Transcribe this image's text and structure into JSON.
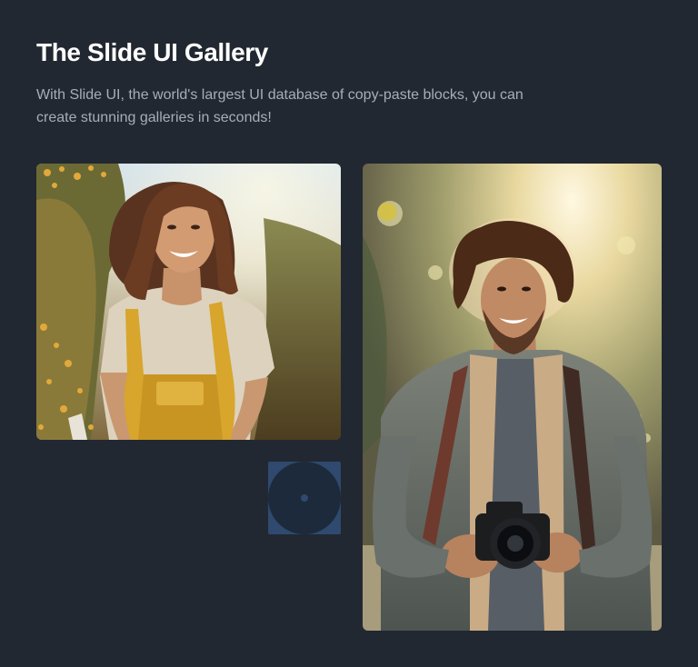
{
  "header": {
    "title": "The Slide UI Gallery",
    "description": "With Slide UI, the world's largest UI database of copy-paste blocks, you can create stunning galleries in seconds!"
  },
  "gallery": {
    "images": [
      {
        "subject": "smiling woman with wavy brown hair in yellow overalls standing among sunlit wildflowers"
      },
      {
        "subject": "smiling man with curly hair holding a camera, backlit by sunlight"
      }
    ],
    "placeholder_icon": "record-disc-icon"
  },
  "colors": {
    "background": "#222831",
    "title": "#ffffff",
    "description": "#a7aeb8",
    "placeholder": "#2f4a6e"
  }
}
